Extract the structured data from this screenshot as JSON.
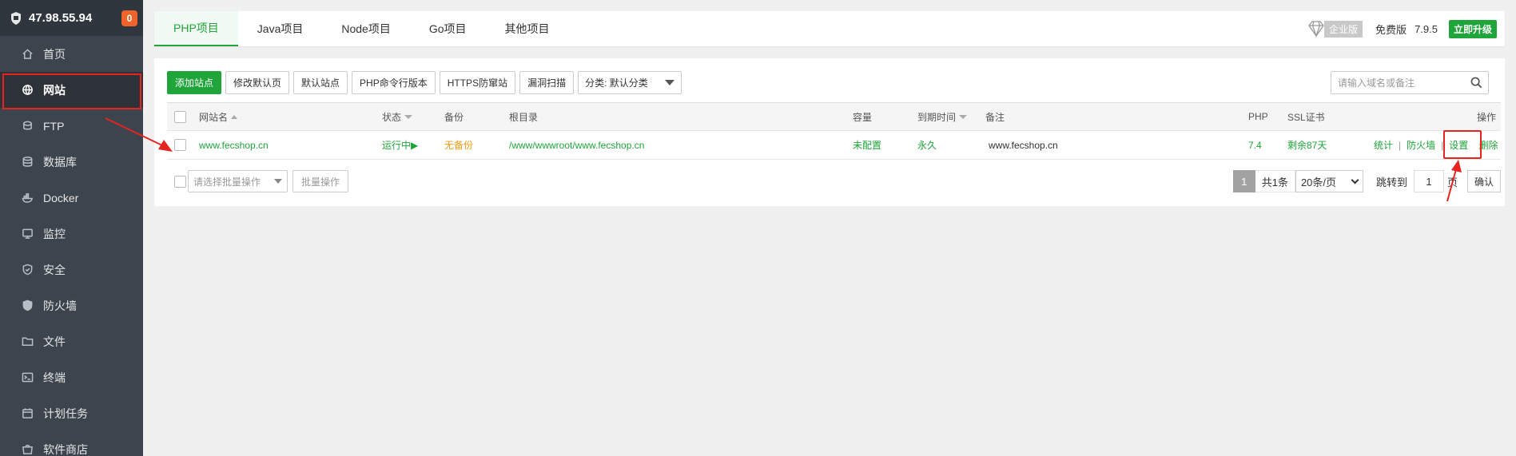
{
  "sidebar": {
    "ip": "47.98.55.94",
    "badge": "0",
    "items": [
      {
        "label": "首页",
        "icon": "home-icon"
      },
      {
        "label": "网站",
        "icon": "globe-icon",
        "active": true
      },
      {
        "label": "FTP",
        "icon": "ftp-icon"
      },
      {
        "label": "数据库",
        "icon": "database-icon"
      },
      {
        "label": "Docker",
        "icon": "docker-icon"
      },
      {
        "label": "监控",
        "icon": "monitor-icon"
      },
      {
        "label": "安全",
        "icon": "shield-check-icon"
      },
      {
        "label": "防火墙",
        "icon": "firewall-shield-icon"
      },
      {
        "label": "文件",
        "icon": "folder-icon"
      },
      {
        "label": "终端",
        "icon": "terminal-icon"
      },
      {
        "label": "计划任务",
        "icon": "calendar-icon"
      },
      {
        "label": "软件商店",
        "icon": "store-icon"
      }
    ]
  },
  "tabs": [
    "PHP项目",
    "Java项目",
    "Node项目",
    "Go项目",
    "其他项目"
  ],
  "top_right": {
    "edition_label": "企业版",
    "free_label": "免费版",
    "version": "7.9.5",
    "upgrade_label": "立即升级"
  },
  "toolbar": {
    "buttons": [
      "添加站点",
      "修改默认页",
      "默认站点",
      "PHP命令行版本",
      "HTTPS防窜站",
      "漏洞扫描"
    ],
    "category_select": "分类: 默认分类",
    "search_placeholder": "请输入域名或备注"
  },
  "table": {
    "headers": {
      "name": "网站名",
      "status": "状态",
      "backup": "备份",
      "root": "根目录",
      "capacity": "容量",
      "expire": "到期时间",
      "remark": "备注",
      "php": "PHP",
      "ssl": "SSL证书",
      "ops": "操作"
    },
    "rows": [
      {
        "name": "www.fecshop.cn",
        "status": "运行中▶",
        "backup": "无备份",
        "root": "/www/wwwroot/www.fecshop.cn",
        "capacity": "未配置",
        "expire": "永久",
        "remark": "www.fecshop.cn",
        "php": "7.4",
        "ssl": "剩余87天",
        "ops": [
          "统计",
          "防火墙",
          "设置",
          "删除"
        ]
      }
    ]
  },
  "footer": {
    "bulk_placeholder": "请选择批量操作",
    "bulk_button": "批量操作",
    "current_page": "1",
    "total": "共1条",
    "page_size": "20条/页",
    "jump_label": "跳转到",
    "jump_value": "1",
    "page_unit": "页",
    "confirm": "确认"
  },
  "colors": {
    "accent": "#20a53a",
    "sidebar_bg": "#3c444d",
    "annotation": "#e8231f",
    "badge": "#f0642b",
    "backup_warning": "#f39c12"
  }
}
